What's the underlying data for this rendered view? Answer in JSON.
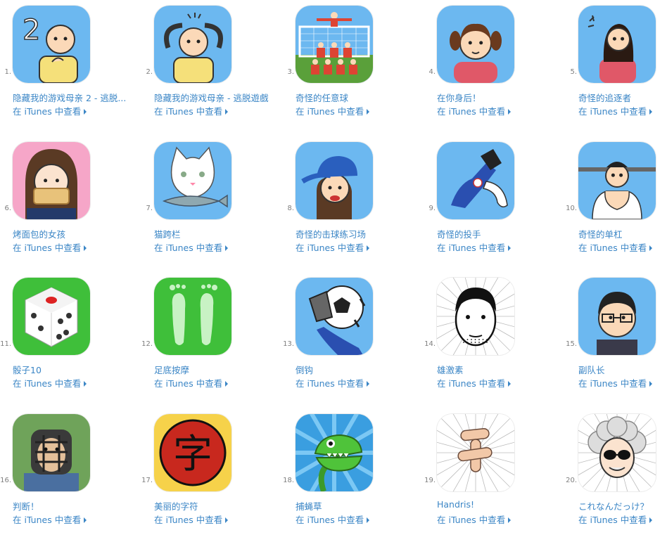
{
  "itunes_label": "在 iTunes 中查看",
  "apps": [
    {
      "rank": "1.",
      "name": "隐藏我的游戏母亲 2 - 逃脱...",
      "icon": "game-boy-thinking-icon"
    },
    {
      "rank": "2.",
      "name": "隐藏我的游戏母亲 - 逃脱遊戲",
      "icon": "game-boy-worried-icon"
    },
    {
      "rank": "3.",
      "name": "奇怪的任意球",
      "icon": "soccer-wall-icon"
    },
    {
      "rank": "4.",
      "name": "在你身后！",
      "icon": "pigtail-girl-icon"
    },
    {
      "rank": "5.",
      "name": "奇怪的追逐者",
      "icon": "woman-red-icon"
    },
    {
      "rank": "6.",
      "name": "烤面包的女孩",
      "icon": "toast-girl-icon"
    },
    {
      "rank": "7.",
      "name": "猫跨栏",
      "icon": "cat-fish-icon"
    },
    {
      "rank": "8.",
      "name": "奇怪的击球练习场",
      "icon": "cap-girl-icon"
    },
    {
      "rank": "9.",
      "name": "奇怪的投手",
      "icon": "pitcher-icon"
    },
    {
      "rank": "10.",
      "name": "奇怪的单杠",
      "icon": "bar-man-icon"
    },
    {
      "rank": "11.",
      "name": "骰子10",
      "icon": "dice-icon"
    },
    {
      "rank": "12.",
      "name": "足底按摩",
      "icon": "feet-icon"
    },
    {
      "rank": "13.",
      "name": "倒钩",
      "icon": "overhead-kick-icon"
    },
    {
      "rank": "14.",
      "name": "雄激素",
      "icon": "manga-face-icon"
    },
    {
      "rank": "15.",
      "name": "副队长",
      "icon": "glasses-man-icon"
    },
    {
      "rank": "16.",
      "name": "判断！",
      "icon": "umpire-icon"
    },
    {
      "rank": "17.",
      "name": "美丽的字符",
      "icon": "kanji-char-icon"
    },
    {
      "rank": "18.",
      "name": "捕蝇草",
      "icon": "flytrap-icon"
    },
    {
      "rank": "19.",
      "name": "Handris!",
      "icon": "finger-block-icon"
    },
    {
      "rank": "20.",
      "name": "これなんだっけ？",
      "icon": "old-professor-icon"
    }
  ]
}
